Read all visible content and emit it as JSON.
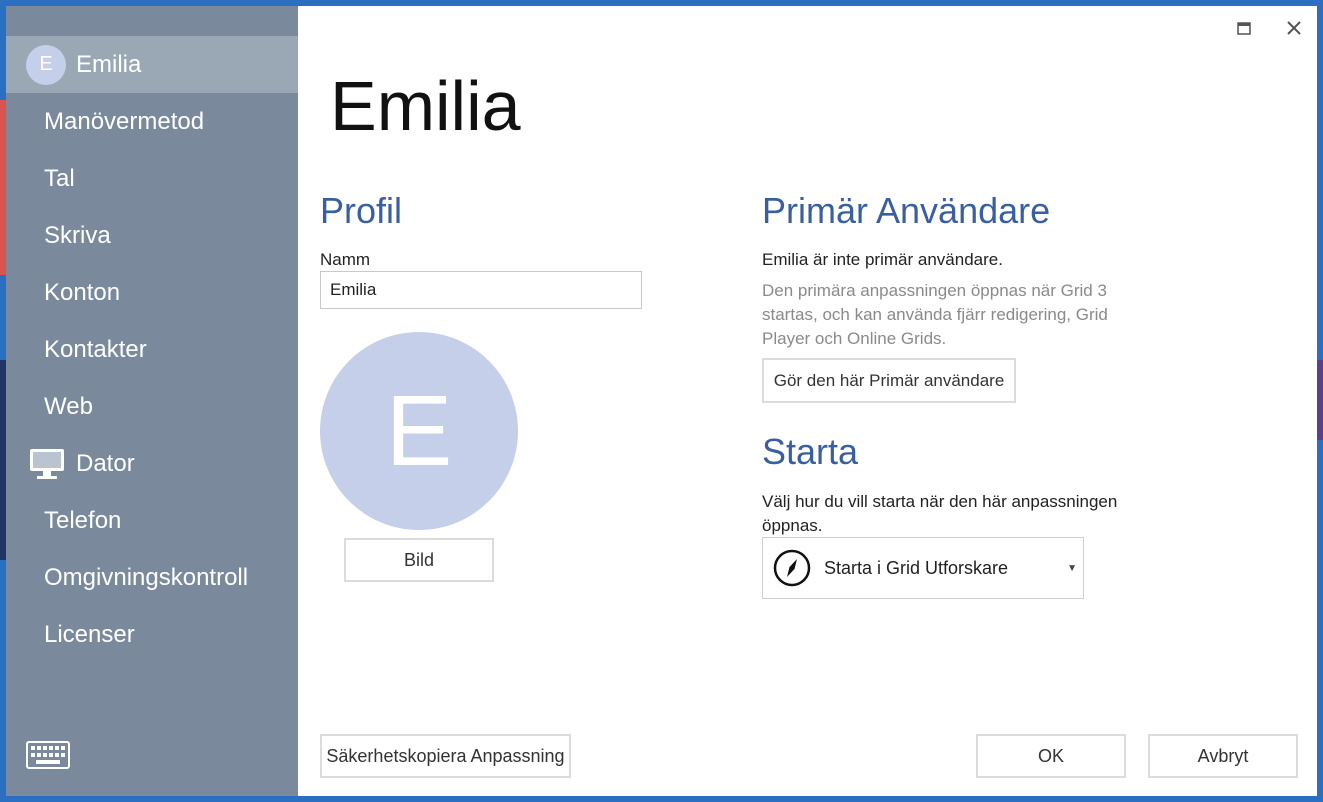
{
  "sidebar": {
    "user": {
      "initial": "E",
      "name": "Emilia"
    },
    "items": [
      {
        "label": "Manövermetod"
      },
      {
        "label": "Tal"
      },
      {
        "label": "Skriva"
      },
      {
        "label": "Konton"
      },
      {
        "label": "Kontakter"
      },
      {
        "label": "Web"
      },
      {
        "label": "Dator",
        "icon": "monitor-icon"
      },
      {
        "label": "Telefon"
      },
      {
        "label": "Omgivningskontroll"
      },
      {
        "label": "Licenser"
      }
    ]
  },
  "window": {
    "maximize_icon": "□",
    "close_icon": "✕"
  },
  "main": {
    "title": "Emilia",
    "profile": {
      "heading": "Profil",
      "name_label": "Namm",
      "name_value": "Emilia",
      "avatar_initial": "E",
      "picture_button": "Bild"
    },
    "primary_user": {
      "heading": "Primär Användare",
      "status": "Emilia är inte primär användare.",
      "description": "Den primära anpassningen öppnas när Grid 3 startas, och kan använda fjärr redigering, Grid Player och Online Grids.",
      "make_primary_button": "Gör den här Primär användare"
    },
    "start": {
      "heading": "Starta",
      "description": "Välj hur du vill starta när den här anpassningen öppnas.",
      "selected_option": "Starta i Grid Utforskare"
    },
    "footer": {
      "backup_button": "Säkerhetskopiera Anpassning",
      "ok_button": "OK",
      "cancel_button": "Avbryt"
    }
  },
  "colors": {
    "sidebar": "#7a8a9c",
    "sidebar_selected": "#9aa7b5",
    "heading": "#3a5fa0",
    "avatar": "#c5cfe9"
  }
}
